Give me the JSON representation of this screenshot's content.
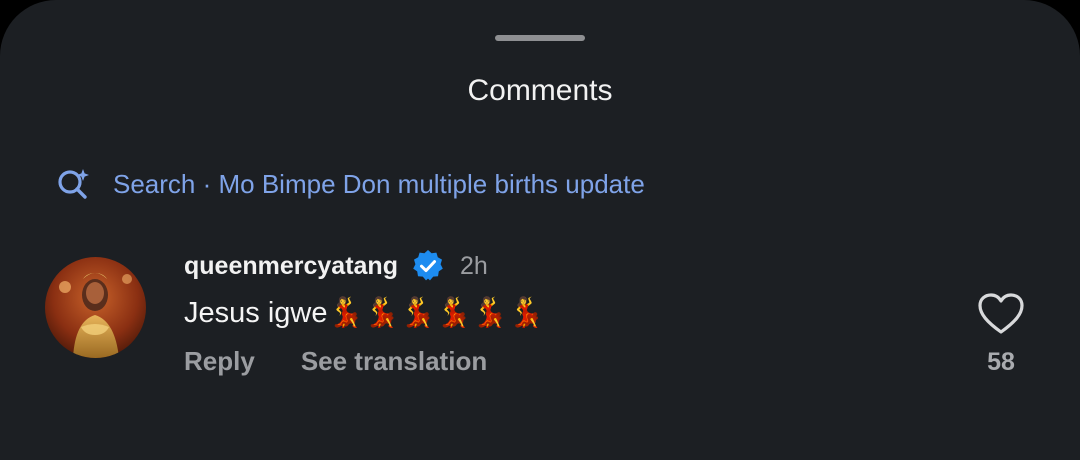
{
  "sheet": {
    "title": "Comments"
  },
  "search": {
    "icon": "search-sparkle-icon",
    "label": "Search · Mo Bimpe Don multiple births update"
  },
  "comment": {
    "avatar": "avatar",
    "username": "queenmercyatang",
    "verified_icon": "verified-badge-icon",
    "time": "2h",
    "text": "Jesus igwe💃💃💃💃💃💃",
    "reply_label": "Reply",
    "translate_label": "See translation",
    "like_icon": "heart-icon",
    "like_count": "58"
  },
  "colors": {
    "background": "#1c1f23",
    "link": "#7fa3e8",
    "verified": "#1d8cf0",
    "muted": "#9b9da1"
  }
}
